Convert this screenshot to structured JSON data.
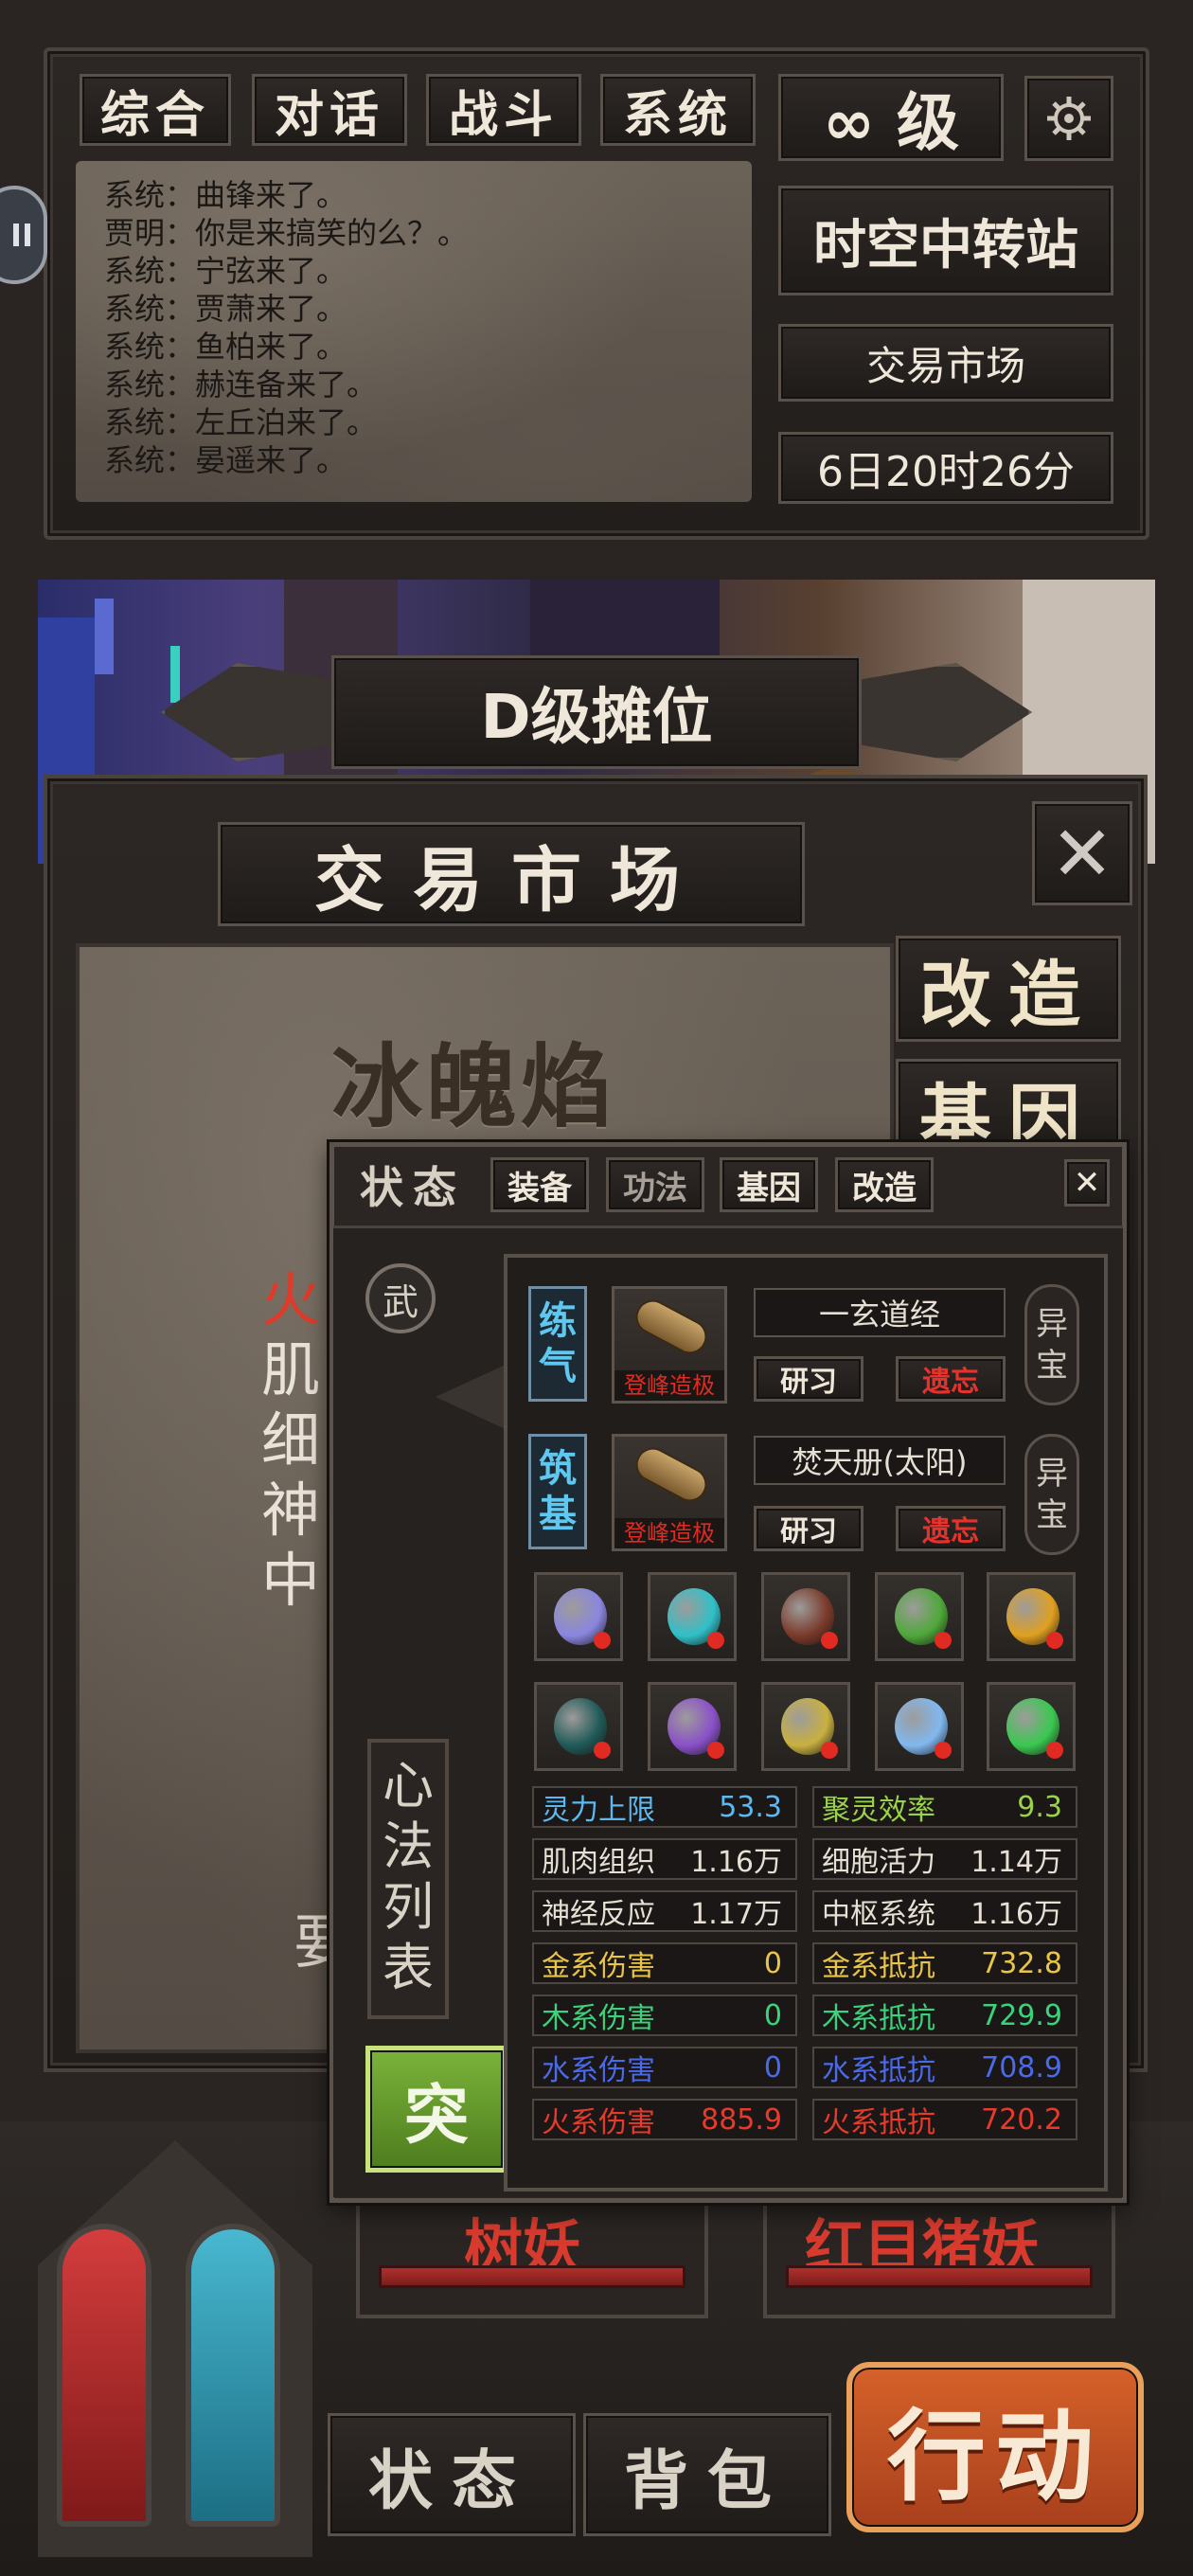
{
  "chat_tabs": [
    "综合",
    "对话",
    "战斗",
    "系统"
  ],
  "chat_lines": [
    "系统：曲锋来了。",
    "贾明：你是来搞笑的么？。",
    "系统：宁弦来了。",
    "系统：贾萧来了。",
    "系统：鱼柏来了。",
    "系统：赫连备来了。",
    "系统：左丘泊来了。",
    "系统：晏遥来了。"
  ],
  "level": "∞ 级",
  "station": "时空中转站",
  "location": "交易市场",
  "time": "6日20时26分",
  "banner": {
    "rank": "D级摊位"
  },
  "market": {
    "title": "交易市场",
    "item_name": "冰魄焰",
    "desc_lines": [
      "火",
      "肌",
      "细",
      "神",
      "中"
    ],
    "desc_lower": "要",
    "side_reform": "改造",
    "side_gene": "基因",
    "monsters": [
      "树妖",
      "红目猪妖"
    ]
  },
  "bottom": {
    "status": "状态",
    "bag": "背包",
    "action": "行动"
  },
  "overlay": {
    "tabs": {
      "status": "状态",
      "equip": "装备",
      "skill": "功法",
      "gene": "基因",
      "reform": "改造"
    },
    "wu": "武",
    "heart_list": "心法列表",
    "break_label": "突",
    "techniques": [
      {
        "realm": "练气",
        "scroll_caption": "登峰造极",
        "name": "一玄道经",
        "study": "研习",
        "forget": "遗忘",
        "tag": "异宝"
      },
      {
        "realm": "筑基",
        "scroll_caption": "登峰造极",
        "name": "焚天册(太阳)",
        "study": "研习",
        "forget": "遗忘",
        "tag": "异宝"
      }
    ],
    "gems": [
      {
        "name": "crescent-gem",
        "color": "#8a86e0"
      },
      {
        "name": "teal-flame-gem",
        "color": "#30c0c8"
      },
      {
        "name": "dark-claw-gem",
        "color": "#7a3a2a"
      },
      {
        "name": "green-flower-gem",
        "color": "#4ea83a"
      },
      {
        "name": "gold-orb-gem",
        "color": "#e0a020"
      },
      {
        "name": "urn-gem",
        "color": "#1f5a58"
      },
      {
        "name": "purple-swirl-gem",
        "color": "#8a50c8"
      },
      {
        "name": "gold-disc-gem",
        "color": "#c8b040"
      },
      {
        "name": "water-drop-gem",
        "color": "#80b8f0"
      },
      {
        "name": "green-swirl-gem",
        "color": "#3ac850"
      }
    ],
    "stats": [
      {
        "label": "灵力上限",
        "value": "53.3",
        "color": "#5cb8f0"
      },
      {
        "label": "聚灵效率",
        "value": "9.3",
        "color": "#9ad24a"
      },
      {
        "label": "肌肉组织",
        "value": "1.16万",
        "color": "#e6dfd3"
      },
      {
        "label": "细胞活力",
        "value": "1.14万",
        "color": "#e6dfd3"
      },
      {
        "label": "神经反应",
        "value": "1.17万",
        "color": "#e6dfd3"
      },
      {
        "label": "中枢系统",
        "value": "1.16万",
        "color": "#e6dfd3"
      },
      {
        "label": "金系伤害",
        "value": "0",
        "color": "#e8c44a"
      },
      {
        "label": "金系抵抗",
        "value": "732.8",
        "color": "#e8c44a"
      },
      {
        "label": "木系伤害",
        "value": "0",
        "color": "#3ad27a"
      },
      {
        "label": "木系抵抗",
        "value": "729.9",
        "color": "#3ad27a"
      },
      {
        "label": "水系伤害",
        "value": "0",
        "color": "#4a6ae8"
      },
      {
        "label": "水系抵抗",
        "value": "708.9",
        "color": "#4a6ae8"
      },
      {
        "label": "火系伤害",
        "value": "885.9",
        "color": "#e83a2a"
      },
      {
        "label": "火系抵抗",
        "value": "720.2",
        "color": "#e83a2a"
      }
    ]
  }
}
